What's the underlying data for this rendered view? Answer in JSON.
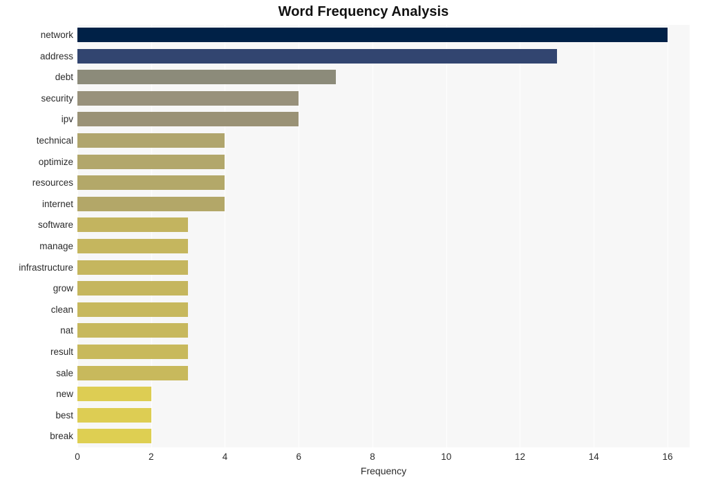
{
  "chart_data": {
    "type": "bar",
    "orientation": "horizontal",
    "title": "Word Frequency Analysis",
    "xlabel": "Frequency",
    "ylabel": "",
    "categories": [
      "network",
      "address",
      "debt",
      "security",
      "ipv",
      "technical",
      "optimize",
      "resources",
      "internet",
      "software",
      "manage",
      "infrastructure",
      "grow",
      "clean",
      "nat",
      "result",
      "sale",
      "new",
      "best",
      "break"
    ],
    "values": [
      16,
      13,
      7,
      6,
      6,
      4,
      4,
      4,
      4,
      3,
      3,
      3,
      3,
      3,
      3,
      3,
      3,
      2,
      2,
      2
    ],
    "bar_colors": [
      "#002147",
      "#324570",
      "#8c8b7a",
      "#98917b",
      "#9a9276",
      "#b0a56d",
      "#b2a76b",
      "#b3a869",
      "#b3a768",
      "#c3b45f",
      "#c5b65e",
      "#c5b65e",
      "#c5b65e",
      "#c7b85d",
      "#c7b85d",
      "#c8b95c",
      "#c8b95c",
      "#ddcd53",
      "#ddcd53",
      "#decf52"
    ],
    "xlim": [
      0,
      16.6
    ],
    "x_ticks": [
      0,
      2,
      4,
      6,
      8,
      10,
      12,
      14,
      16
    ],
    "x_tick_labels": [
      "0",
      "2",
      "4",
      "6",
      "8",
      "10",
      "12",
      "14",
      "16"
    ],
    "grid": true,
    "grid_axis": "x",
    "grid_color": "#ffffff",
    "plot_background": "#f7f7f7",
    "figure_background": "#ffffff",
    "legend": null,
    "legend_position": "none",
    "title_color": "#111111",
    "tick_label_color": "#2b2b2b"
  }
}
